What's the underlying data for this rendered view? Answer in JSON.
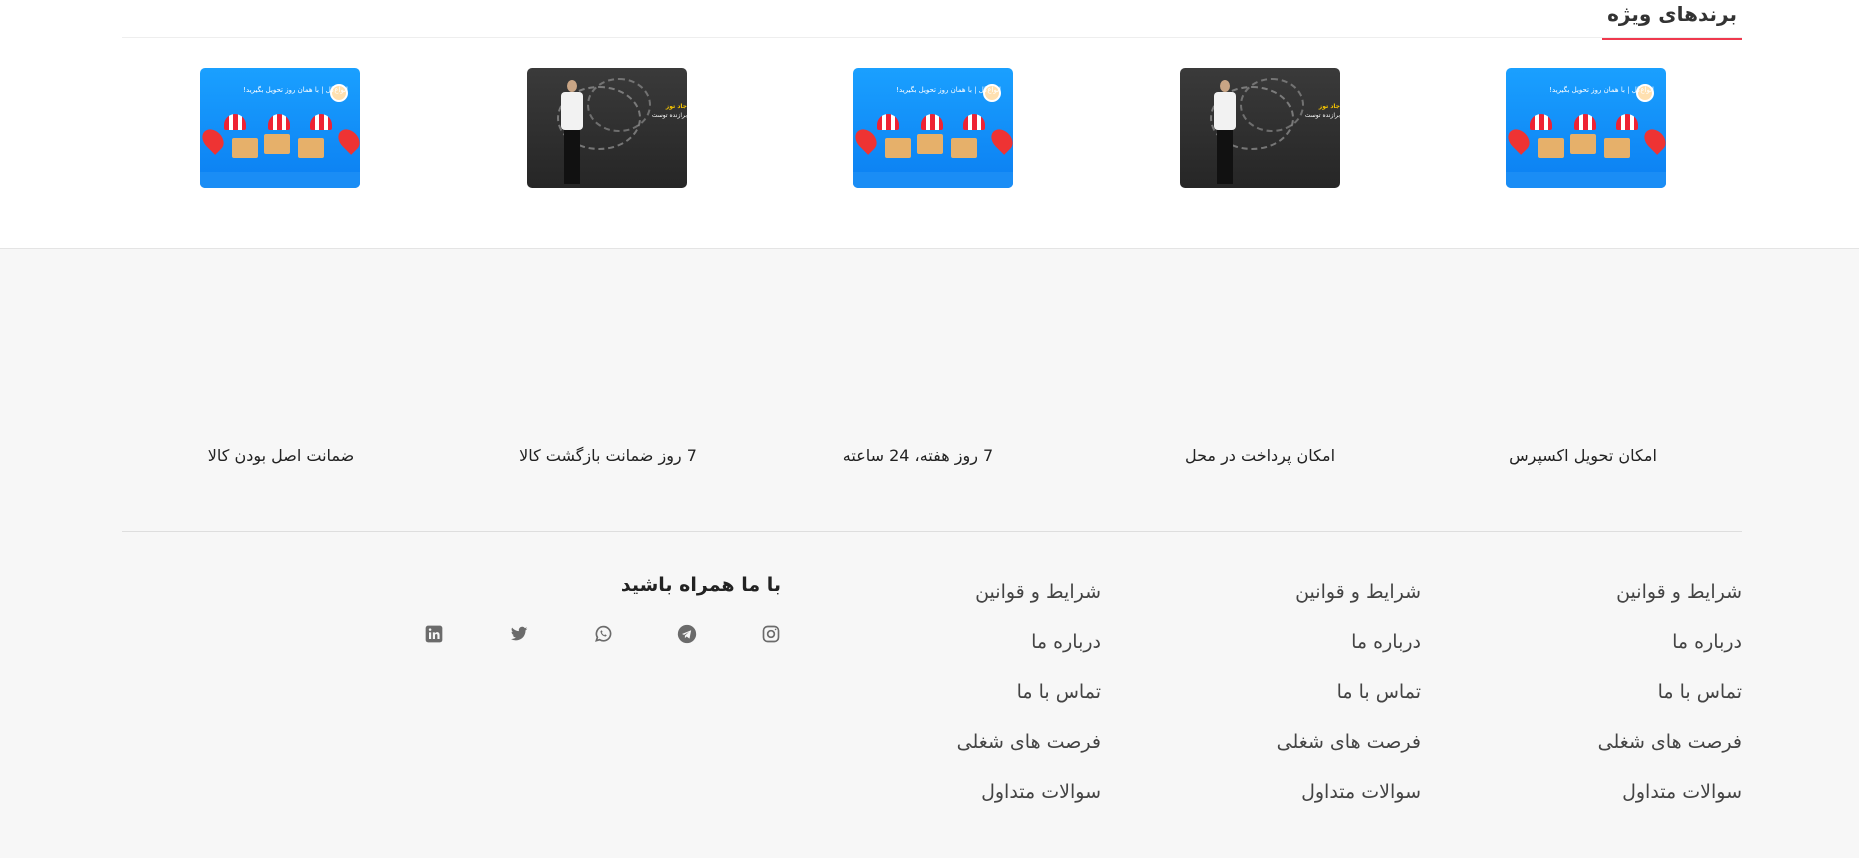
{
  "brands": {
    "title": "برندهای ویژه",
    "cards": [
      {
        "style": "blue",
        "caption": "انواع‌گل | با همان روز تحویل بگیرید!"
      },
      {
        "style": "dark",
        "caption_gold": "جاد توز",
        "caption": "برازنده توست"
      },
      {
        "style": "blue",
        "caption": "انواع‌گل | با همان روز تحویل بگیرید!"
      },
      {
        "style": "dark",
        "caption_gold": "جاد توز",
        "caption": "برازنده توست"
      },
      {
        "style": "blue",
        "caption": "انواع‌گل | با همان روز تحویل بگیرید!"
      }
    ]
  },
  "features": [
    "امکان تحویل اکسپرس",
    "امکان پرداخت در محل",
    "7 روز هفته، 24 ساعته",
    "7 روز ضمانت بازگشت کالا",
    "ضمانت اصل بودن کالا"
  ],
  "link_columns": [
    {
      "links": [
        "شرایط و قوانین",
        "درباره ما",
        "تماس با ما",
        "فرصت های شغلی",
        "سوالات متداول"
      ]
    },
    {
      "links": [
        "شرایط و قوانین",
        "درباره ما",
        "تماس با ما",
        "فرصت های شغلی",
        "سوالات متداول"
      ]
    },
    {
      "links": [
        "شرایط و قوانین",
        "درباره ما",
        "تماس با ما",
        "فرصت های شغلی",
        "سوالات متداول"
      ]
    }
  ],
  "social": {
    "title": "با ما همراه باشید",
    "icons": [
      "instagram-icon",
      "telegram-icon",
      "whatsapp-icon",
      "twitter-icon",
      "linkedin-icon"
    ],
    "icon_color": "#6b6b6b"
  },
  "colors": {
    "accent": "#ef394e",
    "footer_bg": "#f7f7f7"
  }
}
